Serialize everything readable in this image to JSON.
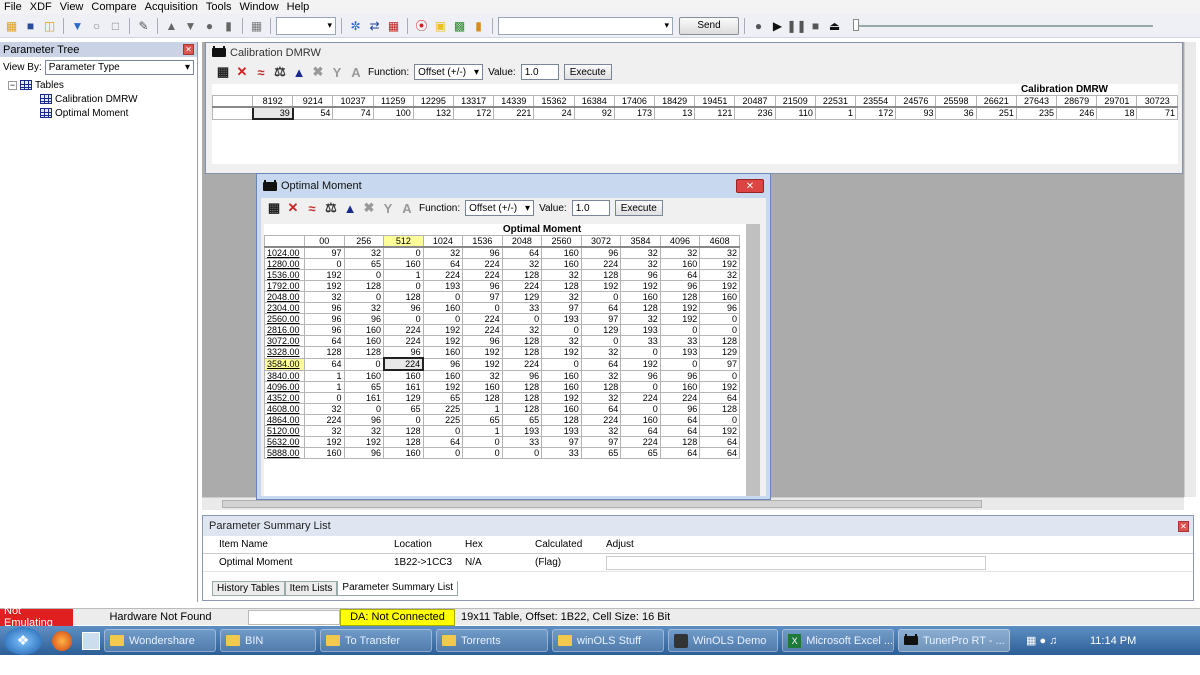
{
  "menu": [
    "File",
    "XDF",
    "View",
    "Compare",
    "Acquisition",
    "Tools",
    "Window",
    "Help"
  ],
  "toolbar": {
    "send_label": "Send",
    "icons": [
      "new-icon",
      "save-icon",
      "open-icon",
      "import-icon",
      "export-icon",
      "blank-icon",
      "script-icon",
      "up-icon",
      "down-icon",
      "record-icon",
      "chart-icon",
      "chip-icon",
      "swap-icon",
      "compare-icon",
      "stop-icon",
      "note-icon",
      "wizard-icon",
      "stats-icon",
      "play-icon",
      "pause-icon",
      "stop-square-icon",
      "eject-icon"
    ]
  },
  "left": {
    "title": "Parameter Tree",
    "viewby_label": "View By:",
    "viewby_value": "Parameter Type",
    "root": "Tables",
    "items": [
      "Calibration DMRW",
      "Optimal Moment"
    ]
  },
  "calib": {
    "title": "Calibration DMRW",
    "function_label": "Function:",
    "function_value": "Offset (+/-)",
    "value_label": "Value:",
    "value": "1.0",
    "execute": "Execute",
    "table_title": "Calibration DMRW",
    "cols": [
      "8192",
      "9214",
      "10237",
      "11259",
      "12295",
      "13317",
      "14339",
      "15362",
      "16384",
      "17406",
      "18429",
      "19451",
      "20487",
      "21509",
      "22531",
      "23554",
      "24576",
      "25598",
      "26621",
      "27643",
      "28679",
      "29701",
      "30723"
    ],
    "values": [
      "39",
      "54",
      "74",
      "100",
      "132",
      "172",
      "221",
      "24",
      "92",
      "173",
      "13",
      "121",
      "236",
      "110",
      "1",
      "172",
      "93",
      "36",
      "251",
      "235",
      "246",
      "18",
      "71"
    ]
  },
  "optimal": {
    "title": "Optimal Moment",
    "function_label": "Function:",
    "function_value": "Offset (+/-)",
    "value_label": "Value:",
    "value": "1.0",
    "execute": "Execute",
    "table_title": "Optimal Moment",
    "cols": [
      "00",
      "256",
      "512",
      "1024",
      "1536",
      "2048",
      "2560",
      "3072",
      "3584",
      "4096",
      "4608"
    ],
    "rows": [
      {
        "h": "1024.00",
        "v": [
          "97",
          "32",
          "0",
          "32",
          "96",
          "64",
          "160",
          "96",
          "32",
          "32",
          "32"
        ]
      },
      {
        "h": "1280.00",
        "v": [
          "0",
          "65",
          "160",
          "64",
          "224",
          "32",
          "160",
          "224",
          "32",
          "160",
          "192"
        ]
      },
      {
        "h": "1536.00",
        "v": [
          "192",
          "0",
          "1",
          "224",
          "224",
          "128",
          "32",
          "128",
          "96",
          "64",
          "32"
        ]
      },
      {
        "h": "1792.00",
        "v": [
          "192",
          "128",
          "0",
          "193",
          "96",
          "224",
          "128",
          "192",
          "192",
          "96",
          "192"
        ]
      },
      {
        "h": "2048.00",
        "v": [
          "32",
          "0",
          "128",
          "0",
          "97",
          "129",
          "32",
          "0",
          "160",
          "128",
          "160"
        ]
      },
      {
        "h": "2304.00",
        "v": [
          "96",
          "32",
          "96",
          "160",
          "0",
          "33",
          "97",
          "64",
          "128",
          "192",
          "96"
        ]
      },
      {
        "h": "2560.00",
        "v": [
          "96",
          "96",
          "0",
          "0",
          "224",
          "0",
          "193",
          "97",
          "32",
          "192",
          "0"
        ]
      },
      {
        "h": "2816.00",
        "v": [
          "96",
          "160",
          "224",
          "192",
          "224",
          "32",
          "0",
          "129",
          "193",
          "0",
          "0"
        ]
      },
      {
        "h": "3072.00",
        "v": [
          "64",
          "160",
          "224",
          "192",
          "96",
          "128",
          "32",
          "0",
          "33",
          "33",
          "128"
        ]
      },
      {
        "h": "3328.00",
        "v": [
          "128",
          "128",
          "96",
          "160",
          "192",
          "128",
          "192",
          "32",
          "0",
          "193",
          "129"
        ]
      },
      {
        "h": "3584.00",
        "v": [
          "64",
          "0",
          "224",
          "96",
          "192",
          "224",
          "0",
          "64",
          "192",
          "0",
          "97"
        ]
      },
      {
        "h": "3840.00",
        "v": [
          "1",
          "160",
          "160",
          "160",
          "32",
          "96",
          "160",
          "32",
          "96",
          "96",
          "0"
        ]
      },
      {
        "h": "4096.00",
        "v": [
          "1",
          "65",
          "161",
          "192",
          "160",
          "128",
          "160",
          "128",
          "0",
          "160",
          "192"
        ]
      },
      {
        "h": "4352.00",
        "v": [
          "0",
          "161",
          "129",
          "65",
          "128",
          "128",
          "192",
          "32",
          "224",
          "224",
          "64"
        ]
      },
      {
        "h": "4608.00",
        "v": [
          "32",
          "0",
          "65",
          "225",
          "1",
          "128",
          "160",
          "64",
          "0",
          "96",
          "128"
        ]
      },
      {
        "h": "4864.00",
        "v": [
          "224",
          "96",
          "0",
          "225",
          "65",
          "65",
          "128",
          "224",
          "160",
          "64",
          "0"
        ]
      },
      {
        "h": "5120.00",
        "v": [
          "32",
          "32",
          "128",
          "0",
          "1",
          "193",
          "193",
          "32",
          "64",
          "64",
          "192"
        ]
      },
      {
        "h": "5632.00",
        "v": [
          "192",
          "192",
          "128",
          "64",
          "0",
          "33",
          "97",
          "97",
          "224",
          "128",
          "64"
        ]
      },
      {
        "h": "5888.00",
        "v": [
          "160",
          "96",
          "160",
          "0",
          "0",
          "0",
          "33",
          "65",
          "65",
          "64",
          "64"
        ]
      }
    ]
  },
  "summary": {
    "title": "Parameter Summary List",
    "headers": [
      "Item Name",
      "Location",
      "Hex",
      "Calculated",
      "Adjust"
    ],
    "row": [
      "Optimal Moment",
      "1B22->1CC3",
      "N/A",
      "(Flag)",
      ""
    ],
    "tabs": [
      "History Tables",
      "Item Lists",
      "Parameter Summary List"
    ]
  },
  "status": {
    "emu": "Not Emulating",
    "hw": "Hardware Not Found",
    "da": "DA: Not Connected",
    "info": "19x11 Table, Offset: 1B22,  Cell Size: 16 Bit"
  },
  "taskbar": {
    "items": [
      "Wondershare",
      "BIN",
      "To Transfer",
      "Torrents",
      "winOLS Stuff",
      "WinOLS Demo",
      "Microsoft Excel ...",
      "TunerPro RT - ..."
    ],
    "time": "11:14 PM"
  },
  "colors": {
    "accent": "#c9d3e5",
    "highlight": "#ffff99",
    "status_red": "#e02020",
    "status_yellow": "#ffff00"
  }
}
